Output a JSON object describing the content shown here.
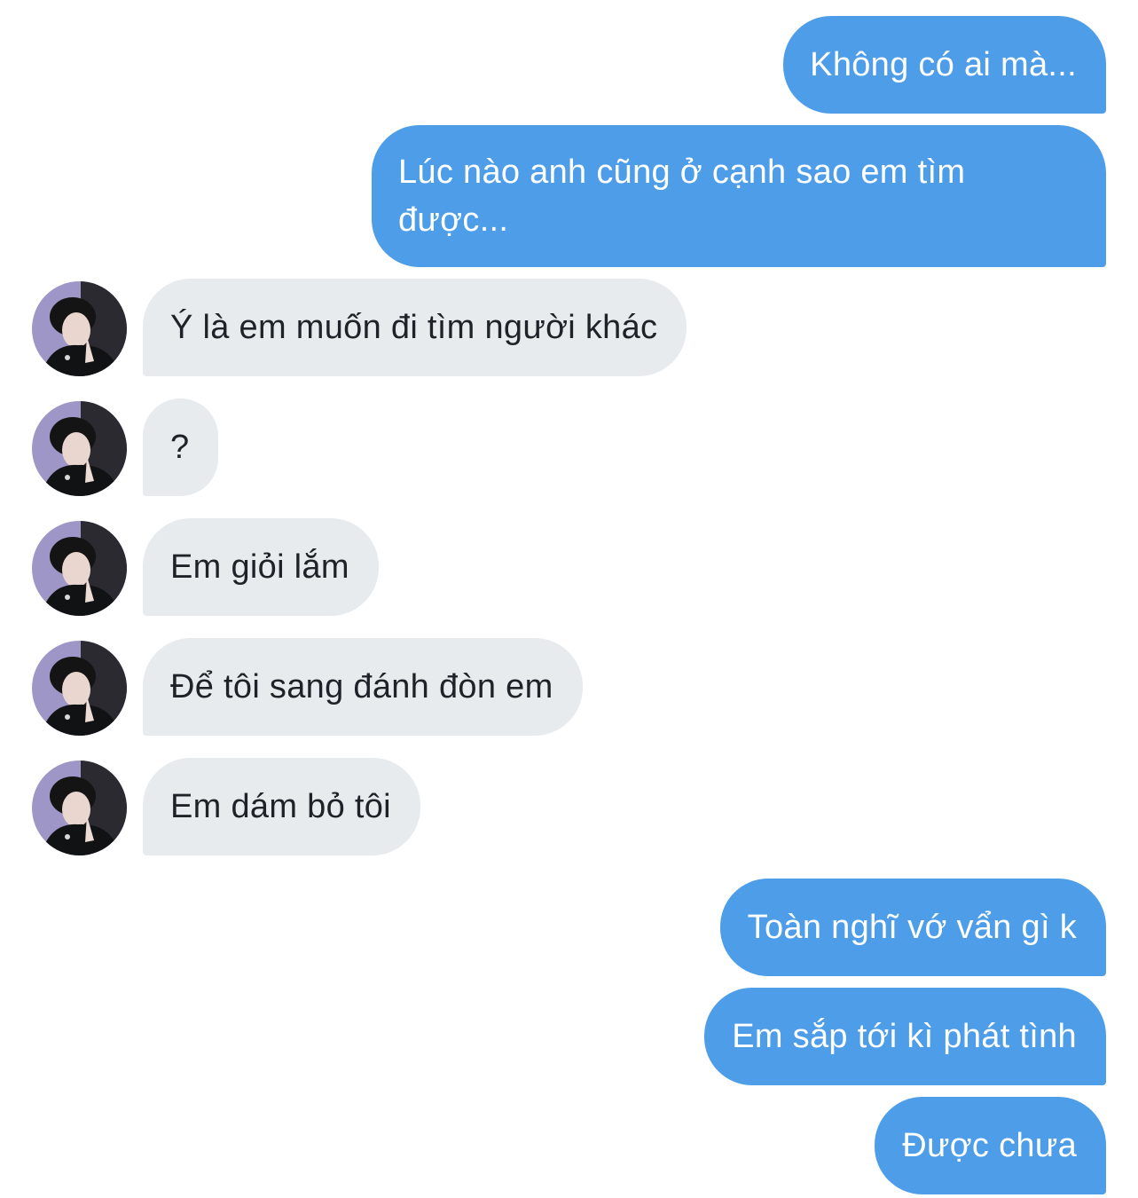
{
  "conversation": {
    "messages": [
      {
        "side": "sent",
        "text": "Không có ai mà..."
      },
      {
        "side": "sent",
        "text": "Lúc nào anh cũng ở cạnh sao em tìm được..."
      },
      {
        "side": "received",
        "text": "Ý là em muốn đi tìm người khác"
      },
      {
        "side": "received",
        "text": "?"
      },
      {
        "side": "received",
        "text": "Em giỏi lắm"
      },
      {
        "side": "received",
        "text": "Để tôi sang đánh đòn em"
      },
      {
        "side": "received",
        "text": "Em dám bỏ tôi"
      },
      {
        "side": "sent",
        "text": "Toàn nghĩ vớ vẩn gì k"
      },
      {
        "side": "sent",
        "text": "Em sắp tới kì phát tình"
      },
      {
        "side": "sent",
        "text": "Được chưa"
      }
    ]
  },
  "colors": {
    "sent_bubble": "#4d9de9",
    "received_bubble": "#e7ebee",
    "received_text": "#1d2328",
    "background": "#ffffff"
  },
  "icons": {
    "avatar": "contact-avatar-photo"
  }
}
